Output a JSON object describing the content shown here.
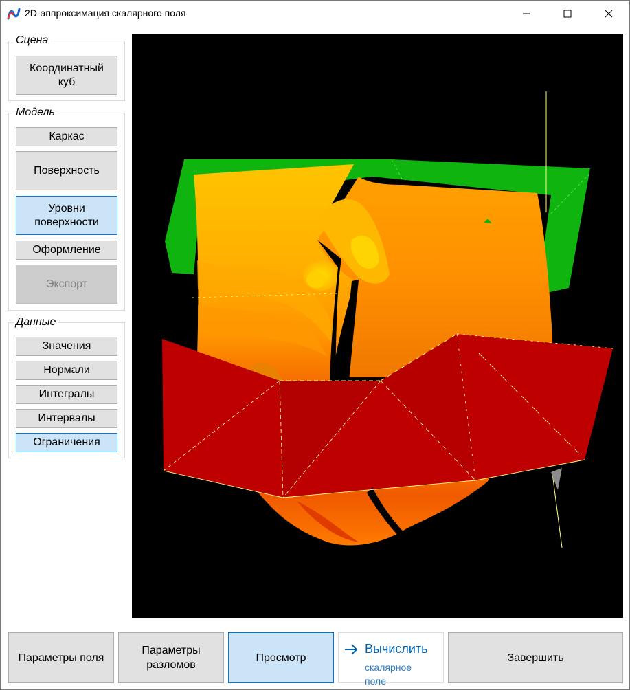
{
  "window": {
    "title": "2D-аппроксимация скалярного поля",
    "app_icon": "app-logo-icon",
    "controls": [
      "minimize-icon",
      "maximize-icon",
      "close-icon"
    ]
  },
  "scene_group": {
    "legend": "Сцена",
    "buttons": [
      {
        "label": "Координатный куб",
        "state": "normal"
      }
    ]
  },
  "model_group": {
    "legend": "Модель",
    "buttons": [
      {
        "label": "Каркас",
        "state": "normal"
      },
      {
        "label": "Поверхность",
        "state": "normal"
      },
      {
        "label": "Уровни поверхности",
        "state": "active"
      },
      {
        "label": "Оформление",
        "state": "normal"
      },
      {
        "label": "Экспорт",
        "state": "disabled"
      }
    ]
  },
  "data_group": {
    "legend": "Данные",
    "buttons": [
      {
        "label": "Значения",
        "state": "normal"
      },
      {
        "label": "Нормали",
        "state": "normal"
      },
      {
        "label": "Интегралы",
        "state": "normal"
      },
      {
        "label": "Интервалы",
        "state": "normal"
      },
      {
        "label": "Ограничения",
        "state": "active"
      }
    ]
  },
  "viewport": {
    "background": "#000000",
    "surface_colors": {
      "top_plane": "#0fb40f",
      "surface_light": "#ffc400",
      "surface_mid": "#ff9a00",
      "surface_dark": "#f05a00",
      "bottom_plane": "#c00000",
      "edge_lines": "#ffff80"
    }
  },
  "bottom_bar": {
    "field_params": "Параметры поля",
    "fault_params": "Параметры разломов",
    "preview": "Просмотр",
    "compute_main": "Вычислить",
    "compute_sub": "скалярное поле",
    "compute_icon": "arrow-right-icon",
    "finish": "Завершить"
  }
}
